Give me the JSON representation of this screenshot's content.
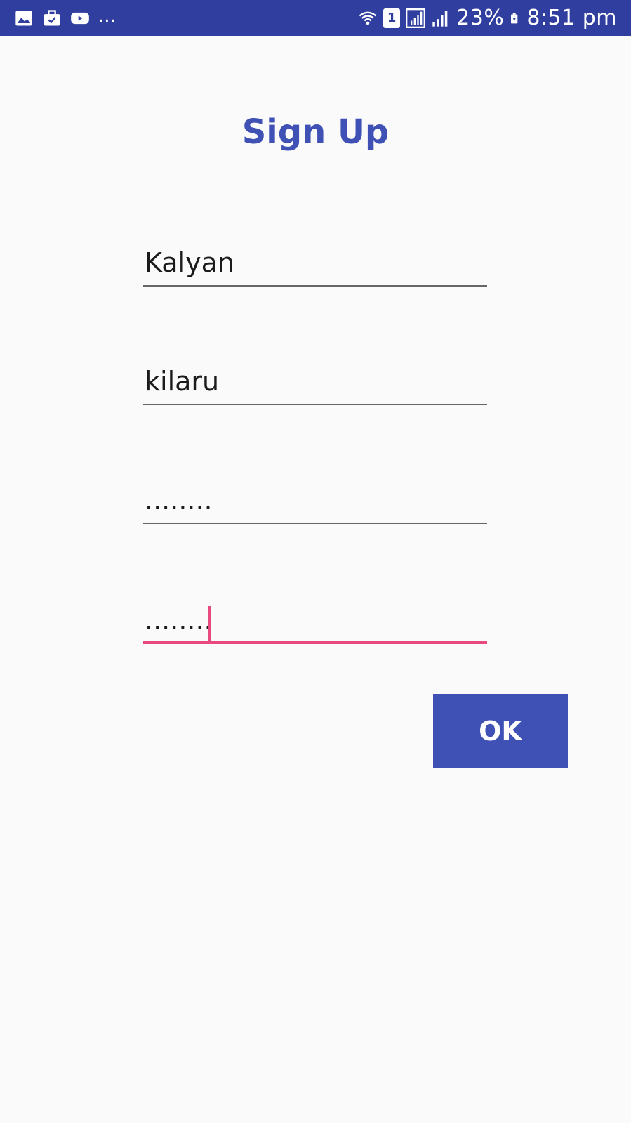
{
  "status_bar": {
    "left_icons": [
      "image-icon",
      "briefcase-check-icon",
      "youtube-icon"
    ],
    "overflow": "...",
    "sim_label": "1",
    "battery_percent": "23%",
    "time": "8:51 pm",
    "right_icons": [
      "wifi-icon",
      "sim-icon",
      "signal-icon",
      "signal-icon",
      "battery-charging-icon"
    ]
  },
  "page": {
    "title": "Sign Up"
  },
  "form": {
    "first_name": "Kalyan",
    "last_name": "kilaru",
    "password": "........",
    "confirm_password": "........"
  },
  "actions": {
    "ok_label": "OK"
  },
  "colors": {
    "status_bar": "#303f9f",
    "accent": "#3f51b5",
    "focus": "#e84a80",
    "background": "#fafafa"
  }
}
